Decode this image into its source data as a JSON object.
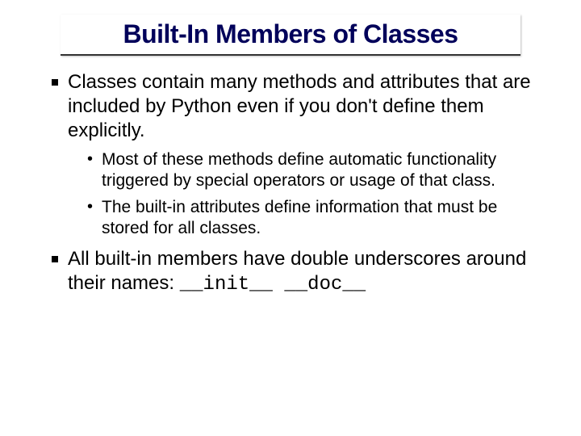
{
  "title": "Built-In Members of Classes",
  "bullets": {
    "b1": "Classes contain many methods and attributes that are included by Python even if you don't define them explicitly.",
    "b1_sub1": "Most of these methods define automatic functionality triggered by special operators or usage of that class.",
    "b1_sub2": "The built-in attributes define information that must be stored for all classes.",
    "b2_text": "All built-in members have double underscores around their names: ",
    "b2_code1": "__init__",
    "b2_spacer": "  ",
    "b2_code2": "__doc__"
  }
}
